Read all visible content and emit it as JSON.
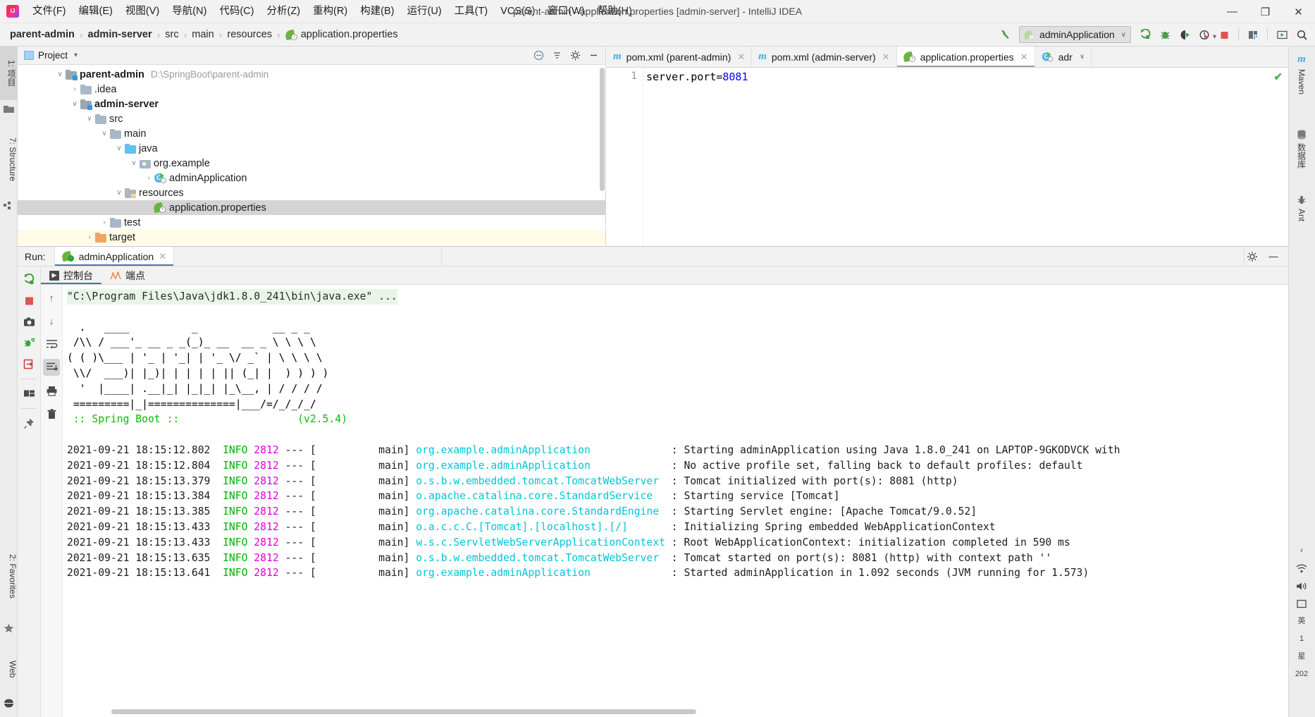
{
  "window": {
    "title": "parent-admin - application.properties [admin-server] - IntelliJ IDEA",
    "minimize": "—",
    "maximize": "❐",
    "close": "✕"
  },
  "menubar": {
    "items": [
      {
        "label": "文件(F)",
        "name": "menu-file"
      },
      {
        "label": "编辑(E)",
        "name": "menu-edit"
      },
      {
        "label": "视图(V)",
        "name": "menu-view"
      },
      {
        "label": "导航(N)",
        "name": "menu-navigate"
      },
      {
        "label": "代码(C)",
        "name": "menu-code"
      },
      {
        "label": "分析(Z)",
        "name": "menu-analyze"
      },
      {
        "label": "重构(R)",
        "name": "menu-refactor"
      },
      {
        "label": "构建(B)",
        "name": "menu-build"
      },
      {
        "label": "运行(U)",
        "name": "menu-run"
      },
      {
        "label": "工具(T)",
        "name": "menu-tools"
      },
      {
        "label": "VCS(S)",
        "name": "menu-vcs"
      },
      {
        "label": "窗口(W)",
        "name": "menu-window"
      },
      {
        "label": "帮助(H)",
        "name": "menu-help"
      }
    ]
  },
  "breadcrumb": {
    "items": [
      {
        "label": "parent-admin",
        "bold": true
      },
      {
        "label": "admin-server",
        "bold": true
      },
      {
        "label": "src",
        "bold": false
      },
      {
        "label": "main",
        "bold": false
      },
      {
        "label": "resources",
        "bold": false
      },
      {
        "label": "application.properties",
        "bold": false
      }
    ],
    "separator": "›"
  },
  "toolbar": {
    "run_configuration": "adminApplication",
    "dropdown_caret": "∨",
    "buttons": [
      {
        "name": "build-hammer-icon",
        "title": "构建"
      },
      {
        "name": "run-button",
        "title": "运行"
      },
      {
        "name": "debug-button",
        "title": "调试"
      },
      {
        "name": "run-with-coverage-button",
        "title": "运行并覆盖"
      },
      {
        "name": "profiler-button",
        "title": "分析器"
      },
      {
        "name": "stop-button",
        "title": "停止"
      },
      {
        "name": "project-structure-button",
        "title": "项目结构"
      },
      {
        "name": "update-button",
        "title": "更新"
      },
      {
        "name": "search-everywhere-icon",
        "title": "搜索"
      }
    ]
  },
  "left_strip": {
    "project_tab": "1: 项目",
    "structure_tab": "7: Structure",
    "favorites_tab": "2: Favorites",
    "web_tab": "Web"
  },
  "right_strip": {
    "maven_tab": "Maven",
    "database_tab": "数据库",
    "ant_tab": "Ant"
  },
  "project_panel": {
    "title": "Project",
    "caret": "▾",
    "tree": [
      {
        "label": "parent-admin",
        "path": "D:\\SpringBoot\\parent-admin",
        "indent": 0,
        "arrow": "∨",
        "icon": "folder-module",
        "bold": true,
        "state": ""
      },
      {
        "label": ".idea",
        "path": "",
        "indent": 1,
        "arrow": "›",
        "icon": "folder-grey",
        "bold": false,
        "state": ""
      },
      {
        "label": "admin-server",
        "path": "",
        "indent": 1,
        "arrow": "∨",
        "icon": "folder-module",
        "bold": true,
        "state": ""
      },
      {
        "label": "src",
        "path": "",
        "indent": 2,
        "arrow": "∨",
        "icon": "folder-grey",
        "bold": false,
        "state": ""
      },
      {
        "label": "main",
        "path": "",
        "indent": 3,
        "arrow": "∨",
        "icon": "folder-grey",
        "bold": false,
        "state": ""
      },
      {
        "label": "java",
        "path": "",
        "indent": 4,
        "arrow": "∨",
        "icon": "folder-blue",
        "bold": false,
        "state": ""
      },
      {
        "label": "org.example",
        "path": "",
        "indent": 5,
        "arrow": "∨",
        "icon": "package",
        "bold": false,
        "state": ""
      },
      {
        "label": "adminApplication",
        "path": "",
        "indent": 6,
        "arrow": "›",
        "icon": "class-run",
        "bold": false,
        "state": ""
      },
      {
        "label": "resources",
        "path": "",
        "indent": 4,
        "arrow": "∨",
        "icon": "folder-resources",
        "bold": false,
        "state": ""
      },
      {
        "label": "application.properties",
        "path": "",
        "indent": 5,
        "arrow": "none",
        "icon": "spring",
        "bold": false,
        "state": "selected"
      },
      {
        "label": "test",
        "path": "",
        "indent": 3,
        "arrow": "›",
        "icon": "folder-grey",
        "bold": false,
        "state": ""
      },
      {
        "label": "target",
        "path": "",
        "indent": 2,
        "arrow": "›",
        "icon": "folder-orange",
        "bold": false,
        "state": "highlight"
      }
    ]
  },
  "editor": {
    "tabs": [
      {
        "label": "pom.xml (parent-admin)",
        "icon": "maven-icon",
        "active": false,
        "close": "✕"
      },
      {
        "label": "pom.xml (admin-server)",
        "icon": "maven-icon",
        "active": false,
        "close": "✕"
      },
      {
        "label": "application.properties",
        "icon": "spring-icon",
        "active": true,
        "close": "✕"
      },
      {
        "label": "adr",
        "icon": "class-icon",
        "active": false,
        "close": "∨"
      }
    ],
    "line_number": "1",
    "code": {
      "key": "server.port",
      "equals": "=",
      "value": "8081"
    },
    "inspection_status": "✔"
  },
  "run_panel": {
    "run_label": "Run:",
    "tab_label": "adminApplication",
    "tab_close": "✕",
    "settings_icon": "gear-icon",
    "minimize_icon": "—",
    "side_buttons": [
      {
        "name": "rerun-button",
        "glyph": "⟳"
      },
      {
        "name": "stop-button",
        "glyph": "■"
      },
      {
        "name": "screenshot-button",
        "glyph": "▣"
      },
      {
        "name": "attach-debugger-button",
        "glyph": "✦"
      },
      {
        "name": "import-button",
        "glyph": "⇥"
      },
      {
        "name": "layout-button",
        "glyph": "▦"
      },
      {
        "name": "pin-button",
        "glyph": "✒"
      }
    ],
    "console_tabs": [
      {
        "label": "控制台",
        "name": "tab-console",
        "active": true
      },
      {
        "label": "端点",
        "name": "tab-endpoints",
        "active": false
      }
    ],
    "console_gutter_buttons": [
      {
        "name": "scroll-up-button",
        "glyph": "↑"
      },
      {
        "name": "scroll-down-button",
        "glyph": "↓"
      },
      {
        "name": "soft-wrap-button",
        "glyph": "↵"
      },
      {
        "name": "scroll-to-end-button",
        "glyph": "↧"
      },
      {
        "name": "print-button",
        "glyph": "⎙"
      },
      {
        "name": "clear-all-button",
        "glyph": "Ὕ1"
      }
    ],
    "console": {
      "command": "\"C:\\Program Files\\Java\\jdk1.8.0_241\\bin\\java.exe\" ...",
      "banner": [
        "  .   ____          _            __ _ _",
        " /\\\\ / ___'_ __ _ _(_)_ __  __ _ \\ \\ \\ \\",
        "( ( )\\___ | '_ | '_| | '_ \\/ _` | \\ \\ \\ \\",
        " \\\\/  ___)| |_)| | | | | || (_| |  ) ) ) )",
        "  '  |____| .__|_| |_|_| |_\\__, | / / / /",
        " =========|_|==============|___/=/_/_/_/"
      ],
      "banner_footer_left": " :: Spring Boot :: ",
      "banner_footer_right": "       (v2.5.4)",
      "log_header": {
        "thread": "main]",
        "dashes": "---",
        "bracket": "["
      },
      "logs": [
        {
          "ts": "2021-09-21 18:15:12.802",
          "level": "INFO",
          "pid": "2812",
          "thread": "main",
          "logger": "org.example.adminApplication",
          "msg": "Starting adminApplication using Java 1.8.0_241 on LAPTOP-9GKODVCK with"
        },
        {
          "ts": "2021-09-21 18:15:12.804",
          "level": "INFO",
          "pid": "2812",
          "thread": "main",
          "logger": "org.example.adminApplication",
          "msg": "No active profile set, falling back to default profiles: default"
        },
        {
          "ts": "2021-09-21 18:15:13.379",
          "level": "INFO",
          "pid": "2812",
          "thread": "main",
          "logger": "o.s.b.w.embedded.tomcat.TomcatWebServer",
          "msg": "Tomcat initialized with port(s): 8081 (http)"
        },
        {
          "ts": "2021-09-21 18:15:13.384",
          "level": "INFO",
          "pid": "2812",
          "thread": "main",
          "logger": "o.apache.catalina.core.StandardService",
          "msg": "Starting service [Tomcat]"
        },
        {
          "ts": "2021-09-21 18:15:13.385",
          "level": "INFO",
          "pid": "2812",
          "thread": "main",
          "logger": "org.apache.catalina.core.StandardEngine",
          "msg": "Starting Servlet engine: [Apache Tomcat/9.0.52]"
        },
        {
          "ts": "2021-09-21 18:15:13.433",
          "level": "INFO",
          "pid": "2812",
          "thread": "main",
          "logger": "o.a.c.c.C.[Tomcat].[localhost].[/]",
          "msg": "Initializing Spring embedded WebApplicationContext"
        },
        {
          "ts": "2021-09-21 18:15:13.433",
          "level": "INFO",
          "pid": "2812",
          "thread": "main",
          "logger": "w.s.c.ServletWebServerApplicationContext",
          "msg": "Root WebApplicationContext: initialization completed in 590 ms"
        },
        {
          "ts": "2021-09-21 18:15:13.635",
          "level": "INFO",
          "pid": "2812",
          "thread": "main",
          "logger": "o.s.b.w.embedded.tomcat.TomcatWebServer",
          "msg": "Tomcat started on port(s): 8081 (http) with context path ''"
        },
        {
          "ts": "2021-09-21 18:15:13.641",
          "level": "INFO",
          "pid": "2812",
          "thread": "main",
          "logger": "org.example.adminApplication",
          "msg": "Started adminApplication in 1.092 seconds (JVM running for 1.573)"
        }
      ]
    }
  },
  "tray": {
    "expand": "‹",
    "wifi": "὏6",
    "volume": "ὐA",
    "ime": "英",
    "time": "1",
    "day": "星",
    "year": "202"
  },
  "colors": {
    "accent_blue": "#3d7ab5",
    "spring_green": "#6db33f",
    "info_green": "#00b200",
    "pid_magenta": "#e000e0",
    "logger_cyan": "#00c5d7",
    "selection_grey": "#d4d4d4",
    "target_highlight": "#fffbe6"
  }
}
